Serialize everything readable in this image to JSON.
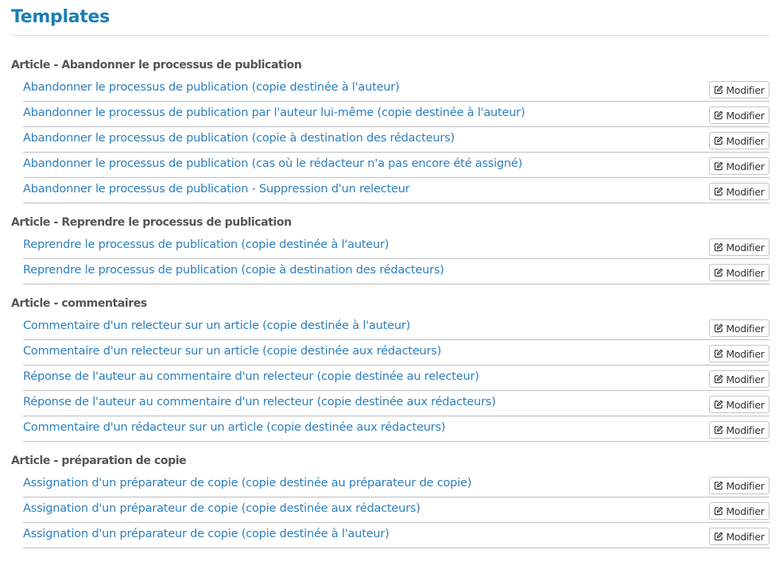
{
  "page": {
    "title": "Templates"
  },
  "edit_label": "Modifier",
  "icons": {
    "edit": "edit-square-pen-icon"
  },
  "colors": {
    "title": "#1a7fb5",
    "link": "#2b7fc0",
    "heading": "#555555"
  },
  "groups": [
    {
      "heading": "Article - Abandonner le processus de publication",
      "items": [
        "Abandonner le processus de publication (copie destinée à l'auteur)",
        "Abandonner le processus de publication par l'auteur lui-même (copie destinée à l'auteur)",
        "Abandonner le processus de publication (copie à destination des rédacteurs)",
        "Abandonner le processus de publication (cas où le rédacteur n'a pas encore été assigné)",
        "Abandonner le processus de publication - Suppression d'un relecteur"
      ]
    },
    {
      "heading": "Article - Reprendre le processus de publication",
      "items": [
        "Reprendre le processus de publication (copie destinée à l'auteur)",
        "Reprendre le processus de publication (copie à destination des rédacteurs)"
      ]
    },
    {
      "heading": "Article - commentaires",
      "items": [
        "Commentaire d'un relecteur sur un article (copie destinée à l'auteur)",
        "Commentaire d'un relecteur sur un article (copie destinée aux rédacteurs)",
        "Réponse de l'auteur au commentaire d'un relecteur (copie destinée au relecteur)",
        "Réponse de l'auteur au commentaire d'un relecteur (copie destinée aux rédacteurs)",
        "Commentaire d'un rédacteur sur un article (copie destinée aux rédacteurs)"
      ]
    },
    {
      "heading": "Article - préparation de copie",
      "items": [
        "Assignation d'un préparateur de copie (copie destinée au préparateur de copie)",
        "Assignation d'un préparateur de copie (copie destinée aux rédacteurs)",
        "Assignation d'un préparateur de copie (copie destinée à l'auteur)"
      ]
    }
  ]
}
